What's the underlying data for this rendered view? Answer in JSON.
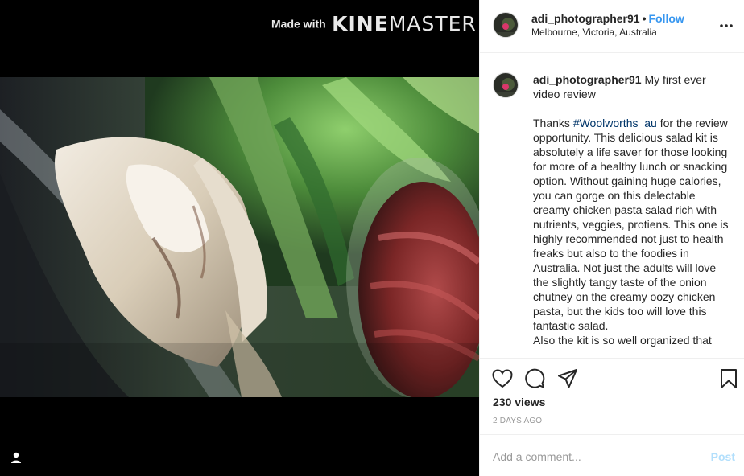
{
  "watermark": {
    "made_with": "Made with",
    "brand_a": "KINE",
    "brand_b": "MASTER"
  },
  "post": {
    "username": "adi_photographer91",
    "separator": "•",
    "follow_label": "Follow",
    "location": "Melbourne, Victoria, Australia"
  },
  "caption": {
    "username": "adi_photographer91",
    "title": "My first ever video review",
    "body_before_tag": "Thanks ",
    "hashtag": "#Woolworths_au",
    "body_after_tag": " for the review opportunity. This delicious salad kit is absolutely a life saver for those looking for more of a healthy lunch or snacking option. Without gaining huge calories, you can gorge on this delectable creamy chicken pasta salad rich with nutrients, veggies, protiens. This one is highly recommended not just to health freaks but also to the foodies in Australia. Not just the adults will love the slightly tangy taste of the onion chutney on the creamy oozy chicken pasta, but the kids too will love this fantastic salad.",
    "body_cutoff": "Also the kit is so well organized that"
  },
  "stats": {
    "views": "230 views",
    "time_ago": "2 DAYS AGO"
  },
  "comment": {
    "placeholder": "Add a comment...",
    "post_label": "Post"
  },
  "icons": {
    "more": "more-options-icon",
    "like": "heart-icon",
    "comment": "comment-bubble-icon",
    "share": "paper-plane-icon",
    "save": "bookmark-icon",
    "user_tag": "user-icon"
  },
  "colors": {
    "link": "#3897f0",
    "hashtag": "#003569",
    "muted": "#999999",
    "post_disabled": "#b2dffc"
  }
}
